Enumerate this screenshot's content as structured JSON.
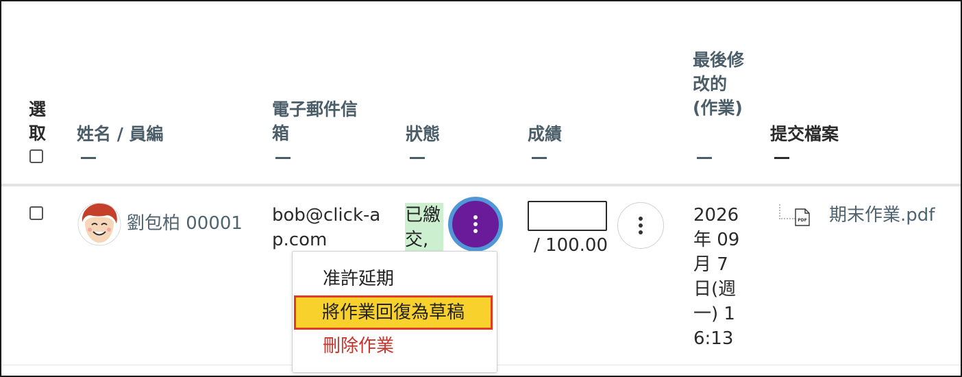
{
  "table": {
    "headers": {
      "select": "選取",
      "name": "姓名 / 員編",
      "email": "電子郵件信箱",
      "status": "狀態",
      "grade": "成績",
      "last_modified": "最後修改的(作業)",
      "files": "提交檔案"
    },
    "rows": [
      {
        "name": "劉包柏 00001",
        "email": "bob@click-ap.com",
        "status": "已繳交,",
        "grade_value": "",
        "grade_max": "/ 100.00",
        "last_modified": "2026年 09月 7日(週一) 16:13",
        "file": "期末作業.pdf"
      }
    ]
  },
  "action_menu": {
    "items": [
      {
        "label": "准許延期"
      },
      {
        "label": "將作業回復為草稿"
      },
      {
        "label": "刪除作業"
      }
    ]
  },
  "icons": {
    "avatar": "avatar-boy-icon",
    "more": "kebab-vertical-icon",
    "file": "pdf-file-icon"
  },
  "colors": {
    "header_text": "#4a5d68",
    "status_submitted_bg": "#ccf0cf",
    "action_button": "#6a1b9a",
    "focus_ring": "#4f97d6",
    "menu_highlight": "#f9d12c",
    "menu_highlight_border": "#e23b1f",
    "danger": "#c9342b"
  }
}
